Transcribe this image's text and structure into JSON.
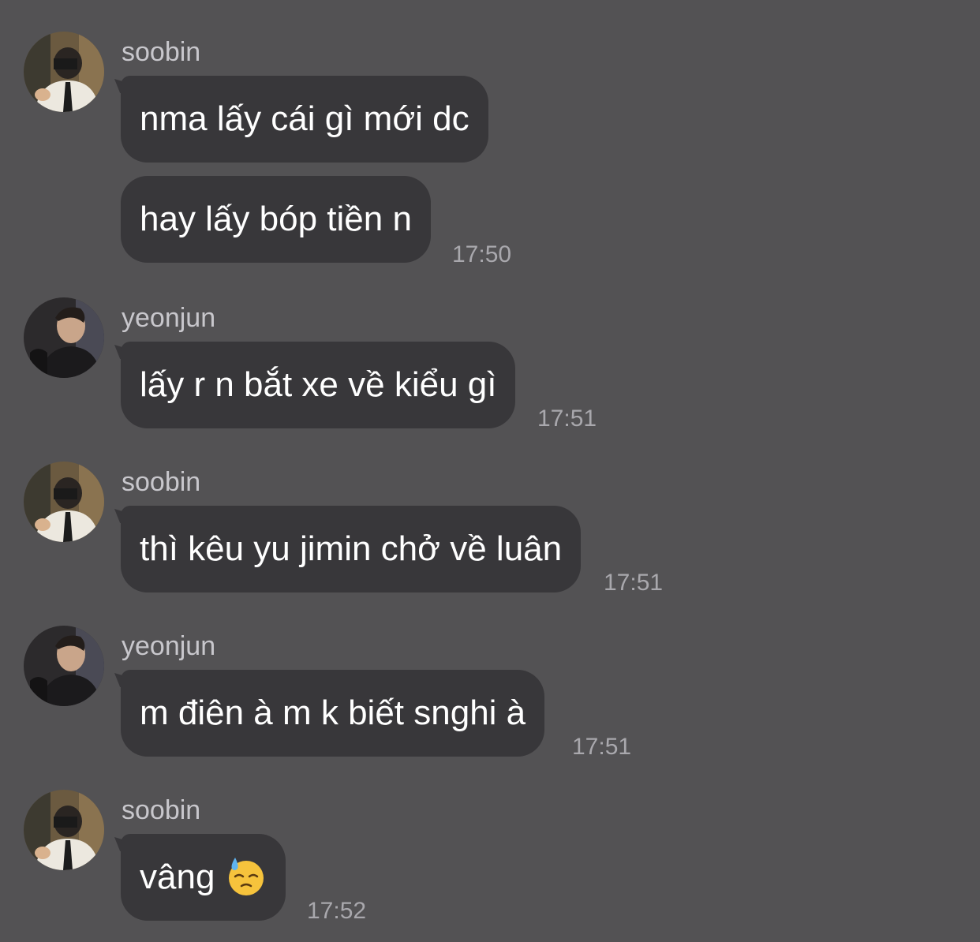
{
  "colors": {
    "background": "#535254",
    "bubble": "#38373a",
    "sender_text": "#c8c7cc",
    "time_text": "#a9a8ad"
  },
  "groups": [
    {
      "sender": "soobin",
      "messages": [
        {
          "text": "nma lấy cái gì mới dc"
        },
        {
          "text": "hay lấy bóp tiền n",
          "time": "17:50"
        }
      ]
    },
    {
      "sender": "yeonjun",
      "messages": [
        {
          "text": "lấy r n bắt xe về kiểu gì",
          "time": "17:51"
        }
      ]
    },
    {
      "sender": "soobin",
      "messages": [
        {
          "text": "thì kêu yu jimin chở về luân",
          "time": "17:51"
        }
      ]
    },
    {
      "sender": "yeonjun",
      "messages": [
        {
          "text": "m điên à m k biết snghi à",
          "time": "17:51"
        }
      ]
    },
    {
      "sender": "soobin",
      "messages": [
        {
          "text": "vâng",
          "emoji": "downcast-face-with-sweat-emoji",
          "time": "17:52"
        }
      ]
    }
  ]
}
